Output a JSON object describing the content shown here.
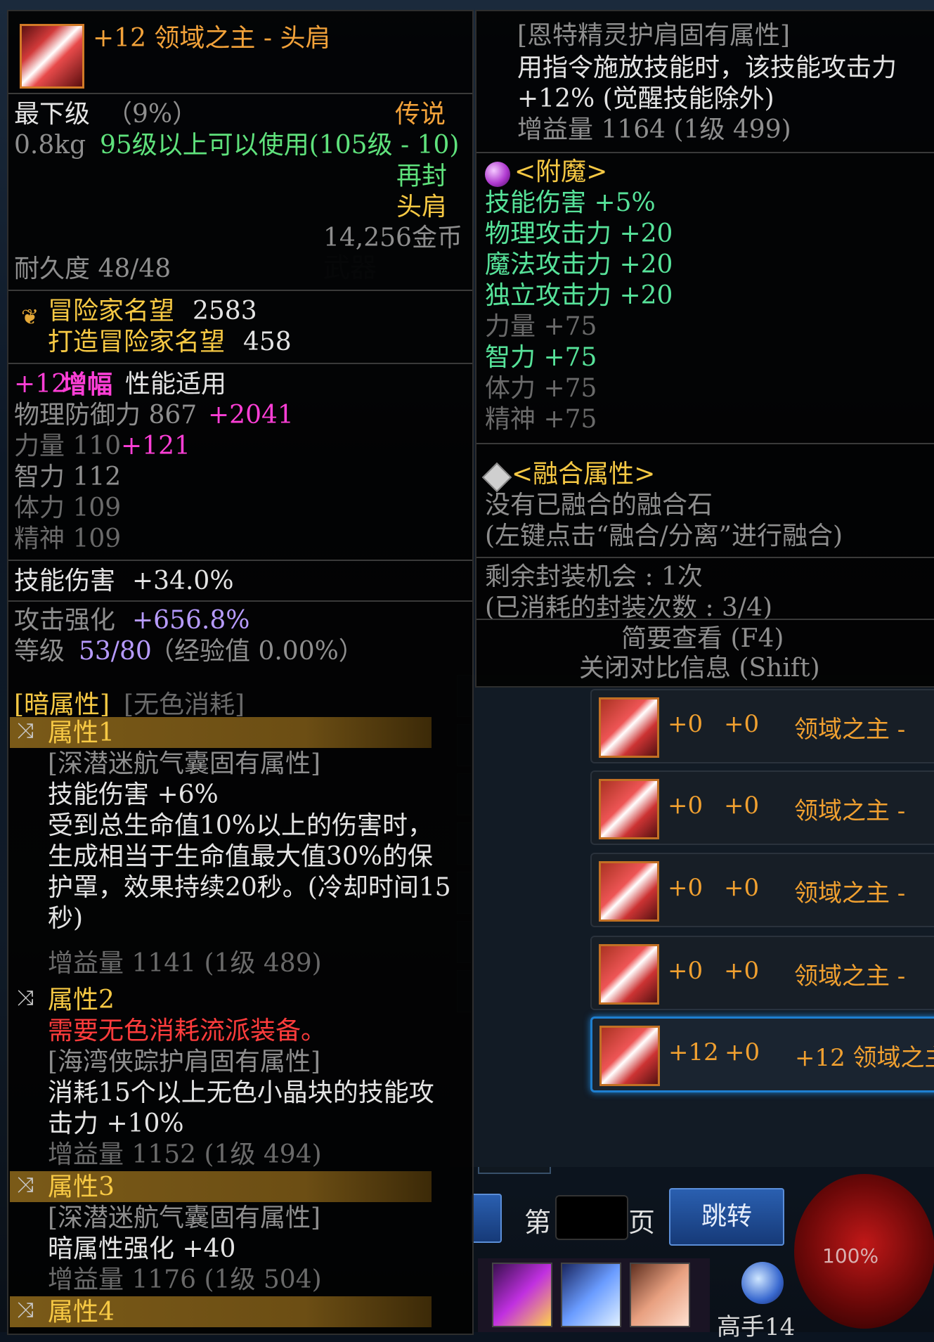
{
  "left_tooltip": {
    "title": "+12 领域之主 - 头肩",
    "grade": "最下级",
    "grade_pct": "（9%）",
    "rarity": "传说",
    "weight": "0.8kg",
    "level_req": "95级以上可以使用(105级 - 10)",
    "reseal": "再封",
    "slot": "头肩",
    "price": "14,256金币",
    "durability": "耐久度 48/48",
    "fame_label": "冒险家名望",
    "fame_value": "2583",
    "craft_fame_label": "打造冒险家名望",
    "craft_fame_value": "458",
    "amp_prefix": "+12",
    "amp_word": "增幅",
    "amp_suffix": "性能适用",
    "stats": [
      {
        "label": "物理防御力 867",
        "bonus": "+2041"
      },
      {
        "label": "力量 110",
        "bonus": "+121"
      },
      {
        "label": "智力 112",
        "bonus": ""
      },
      {
        "label": "体力 109",
        "bonus": ""
      },
      {
        "label": "精神 109",
        "bonus": ""
      }
    ],
    "skill_dmg_label": "技能伤害",
    "skill_dmg_value": "+34.0%",
    "atk_label": "攻击强化",
    "atk_value": "+656.8%",
    "level_label": "等级",
    "level_value": "53/80",
    "exp_text": "（经验值 0.00%）",
    "dark_attr": "[暗属性]",
    "colorless": "[无色消耗]",
    "attr1": {
      "name": "属性1",
      "source": "[深潜迷航气囊固有属性]",
      "lines": [
        "技能伤害 +6%",
        "受到总生命值10%以上的伤害时，",
        "生成相当于生命值最大值30%的保",
        "护罩，效果持续20秒。(冷却时间15",
        "秒)"
      ],
      "gain": "增益量 1141 (1级 489)"
    },
    "attr2": {
      "name": "属性2",
      "requirement": "需要无色消耗流派装备。",
      "source": "[海湾侠踪护肩固有属性]",
      "lines": [
        "消耗15个以上无色小晶块的技能攻",
        "击力 +10%"
      ],
      "gain": "增益量 1152 (1级 494)"
    },
    "attr3": {
      "name": "属性3",
      "source": "[深潜迷航气囊固有属性]",
      "lines": [
        "暗属性强化 +40"
      ],
      "gain": "增益量 1176 (1级 504)"
    },
    "attr4": {
      "name": "属性4"
    }
  },
  "right_tooltip": {
    "source": "[恩特精灵护肩固有属性]",
    "lines": [
      "用指令施放技能时，该技能攻击力",
      "+12% (觉醒技能除外)"
    ],
    "gain": "增益量 1164 (1级 499)",
    "enchant_title": "<附魔>",
    "enchant": [
      {
        "text": "技能伤害 +5%",
        "tone": "green"
      },
      {
        "text": "物理攻击力 +20",
        "tone": "green"
      },
      {
        "text": "魔法攻击力 +20",
        "tone": "green"
      },
      {
        "text": "独立攻击力 +20",
        "tone": "green"
      },
      {
        "text": "力量 +75",
        "tone": "gray"
      },
      {
        "text": "智力 +75",
        "tone": "green"
      },
      {
        "text": "体力 +75",
        "tone": "gray"
      },
      {
        "text": "精神 +75",
        "tone": "gray"
      }
    ],
    "fusion_title": "<融合属性>",
    "fusion_lines": [
      "没有已融合的融合石",
      "(左键点击“融合/分离”进行融合)"
    ],
    "seal_left": "剩余封装机会 : 1次",
    "seal_used": "(已消耗的封装次数 : 3/4)",
    "brief": "简要查看 (F4)",
    "close_compare": "关闭对比信息 (Shift)"
  },
  "background": {
    "rows": [
      {
        "a": "+0",
        "b": "+0",
        "name": "领域之主 -"
      },
      {
        "a": "+0",
        "b": "+0",
        "name": "领域之主 -"
      },
      {
        "a": "+0",
        "b": "+0",
        "name": "领域之主 -"
      },
      {
        "a": "+0",
        "b": "+0",
        "name": "领域之主 -"
      },
      {
        "a": "+12",
        "b": "+0",
        "name": "+12 领域之主"
      }
    ],
    "page_prefix": "第",
    "page_suffix": "页",
    "jump": "跳转",
    "orb_pct": "100%",
    "channel": "高手14"
  }
}
